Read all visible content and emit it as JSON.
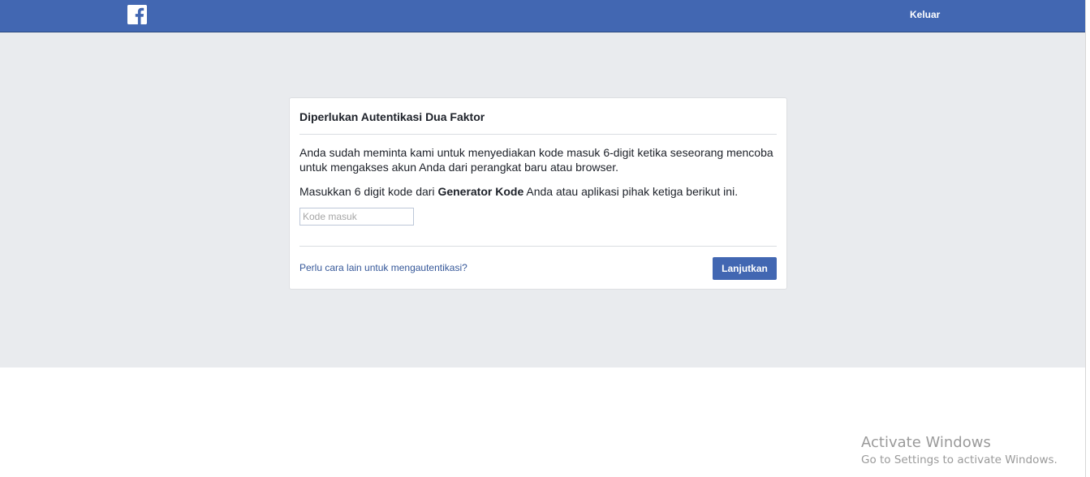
{
  "header": {
    "logo_icon": "facebook-f-icon",
    "logout_label": "Keluar",
    "bar_color": "#4267b2"
  },
  "dialog": {
    "title": "Diperlukan Autentikasi Dua Faktor",
    "description": "Anda sudah meminta kami untuk menyediakan kode masuk 6-digit ketika seseorang mencoba untuk mengakses akun Anda dari perangkat baru atau browser.",
    "instruction_prefix": "Masukkan 6 digit kode dari ",
    "instruction_bold": "Generator Kode",
    "instruction_suffix": " Anda atau aplikasi pihak ketiga berikut ini.",
    "code_input": {
      "placeholder": "Kode masuk",
      "value": ""
    },
    "alt_method_link": "Perlu cara lain untuk mengautentikasi?",
    "continue_button": "Lanjutkan"
  },
  "watermark": {
    "title": "Activate Windows",
    "subtitle": "Go to Settings to activate Windows."
  }
}
